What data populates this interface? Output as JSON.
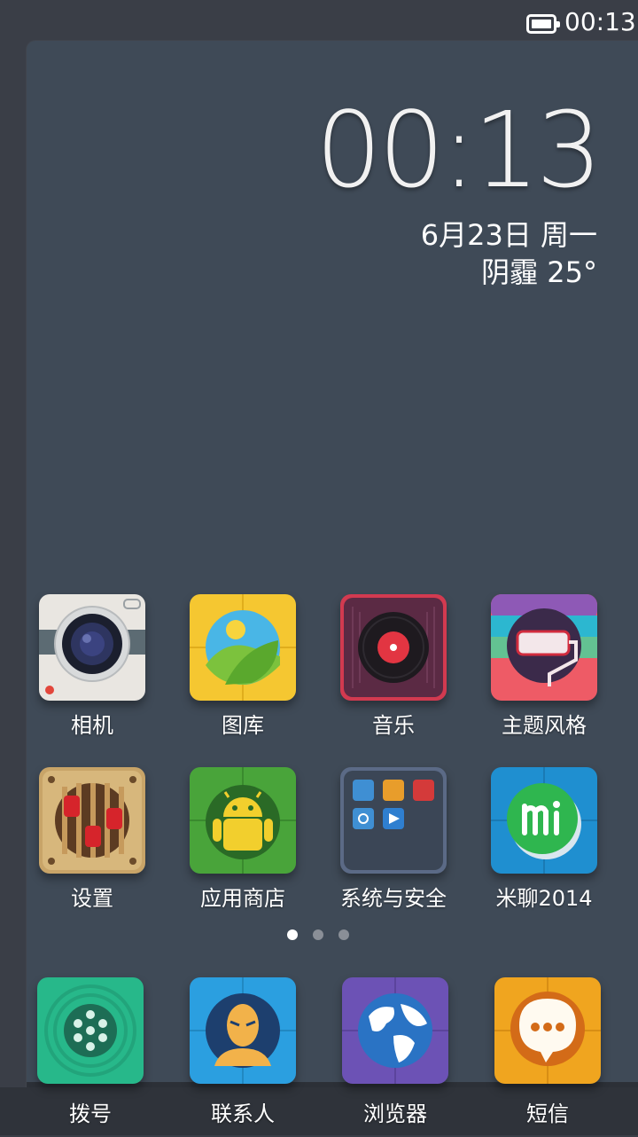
{
  "statusbar": {
    "time": "00:13",
    "battery_icon": "battery-icon"
  },
  "clock": {
    "time": "00:13",
    "date": "6月23日 周一",
    "weather": "阴霾  25°"
  },
  "apps": [
    {
      "label": "相机",
      "icon": "camera-icon"
    },
    {
      "label": "图库",
      "icon": "gallery-icon"
    },
    {
      "label": "音乐",
      "icon": "music-icon"
    },
    {
      "label": "主题风格",
      "icon": "theme-icon"
    },
    {
      "label": "设置",
      "icon": "settings-icon"
    },
    {
      "label": "应用商店",
      "icon": "app-store-icon"
    },
    {
      "label": "系统与安全",
      "icon": "folder-icon"
    },
    {
      "label": "米聊2014",
      "icon": "miliao-icon"
    }
  ],
  "pager": {
    "pages": 3,
    "active": 0
  },
  "dock": [
    {
      "label": "拨号",
      "icon": "dialer-icon"
    },
    {
      "label": "联系人",
      "icon": "contacts-icon"
    },
    {
      "label": "浏览器",
      "icon": "browser-icon"
    },
    {
      "label": "短信",
      "icon": "messages-icon"
    }
  ]
}
